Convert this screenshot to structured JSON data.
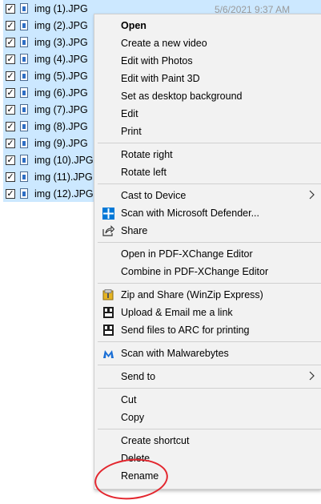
{
  "files": [
    {
      "name": "img (1).JPG",
      "checked": true
    },
    {
      "name": "img (2).JPG",
      "checked": true
    },
    {
      "name": "img (3).JPG",
      "checked": true
    },
    {
      "name": "img (4).JPG",
      "checked": true
    },
    {
      "name": "img (5).JPG",
      "checked": true
    },
    {
      "name": "img (6).JPG",
      "checked": true
    },
    {
      "name": "img (7).JPG",
      "checked": true
    },
    {
      "name": "img (8).JPG",
      "checked": true
    },
    {
      "name": "img (9).JPG",
      "checked": true
    },
    {
      "name": "img (10).JPG",
      "checked": true
    },
    {
      "name": "img (11).JPG",
      "checked": true
    },
    {
      "name": "img (12).JPG",
      "checked": true
    }
  ],
  "file_date": "5/6/2021 9:37 AM",
  "menu": {
    "open": "Open",
    "create_video": "Create a new video",
    "edit_photos": "Edit with Photos",
    "edit_paint3d": "Edit with Paint 3D",
    "set_background": "Set as desktop background",
    "edit": "Edit",
    "print": "Print",
    "rotate_right": "Rotate right",
    "rotate_left": "Rotate left",
    "cast": "Cast to Device",
    "defender": "Scan with Microsoft Defender...",
    "share": "Share",
    "open_pdfx": "Open in PDF-XChange Editor",
    "combine_pdfx": "Combine in PDF-XChange Editor",
    "winzip": "Zip and Share (WinZip Express)",
    "upload_email": "Upload & Email me a link",
    "send_arc": "Send files to ARC for printing",
    "malwarebytes": "Scan with Malwarebytes",
    "send_to": "Send to",
    "cut": "Cut",
    "copy": "Copy",
    "create_shortcut": "Create shortcut",
    "delete": "Delete",
    "rename": "Rename"
  },
  "icons": {
    "submenu": "chevron-right-icon",
    "defender": "shield-icon",
    "share": "share-icon",
    "winzip": "winzip-icon",
    "arc": "arc-icon",
    "malwarebytes": "malwarebytes-icon"
  },
  "colors": {
    "selection": "#cce8ff",
    "annotation": "#e3262e",
    "defender_blue": "#0078d7",
    "malwarebytes_blue": "#1a6fd6"
  }
}
